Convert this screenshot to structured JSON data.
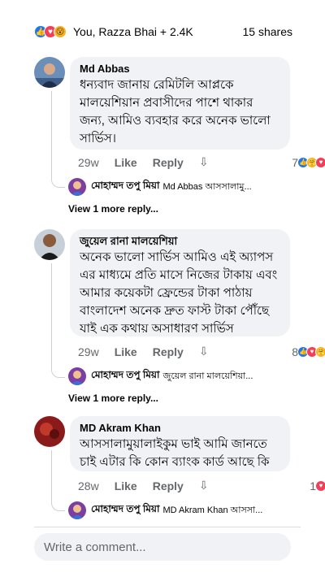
{
  "summary": {
    "reactions": [
      "like-icon",
      "love-icon",
      "wow-icon"
    ],
    "who": "You, Razza Bhai + 2.4K",
    "shares": "15 shares"
  },
  "labels": {
    "like": "Like",
    "reply": "Reply",
    "view_more": "View 1 more reply..."
  },
  "comments": [
    {
      "name": "Md Abbas",
      "text": "ধন্যবাদ জানায় রেমিটলি আপ্লকে মালয়েশিয়ান প্রবাসীদের পাশে থাকার জন্য, আমিও ব্যবহার করে অনেক ভালো সার্ভিস।",
      "time": "29w",
      "reaction_count": "7",
      "reactions": [
        "like-icon",
        "care-icon",
        "love-icon"
      ],
      "reply_name": "মোহাম্মদ তপু মিয়া",
      "reply_text": "Md Abbas আসসালামু..."
    },
    {
      "name": "জুয়েল রানা মালয়েশিয়া",
      "text": "অনেক ভালো সার্ভিস আমিও এই অ্যাপস এর মাধ্যমে প্রতি মাসে নিজের টাকায় এবং আমার কয়েকটা ফ্রেন্ডের টাকা পাঠায় বাংলাদেশ অনেক দ্রুত ফাস্ট টাকা পৌঁছে যাই এক কথায় অসাধারণ সার্ভিস",
      "time": "29w",
      "reaction_count": "8",
      "reactions": [
        "like-icon",
        "love-icon",
        "care-icon"
      ],
      "reply_name": "মোহাম্মদ তপু মিয়া",
      "reply_text": "জুয়েল রানা মালয়েশিয়া..."
    },
    {
      "name": "MD Akram Khan",
      "text": "আসসালামুয়ালাইকুম ভাই আমি জানতে চাই এটার কি কোন ব্যাংক কার্ড আছে কি",
      "time": "28w",
      "reaction_count": "1",
      "reactions": [
        "love-icon"
      ],
      "reply_name": "মোহাম্মদ তপু মিয়া",
      "reply_text": "MD Akram Khan আসসা..."
    }
  ],
  "composer": {
    "placeholder": "Write a comment..."
  }
}
